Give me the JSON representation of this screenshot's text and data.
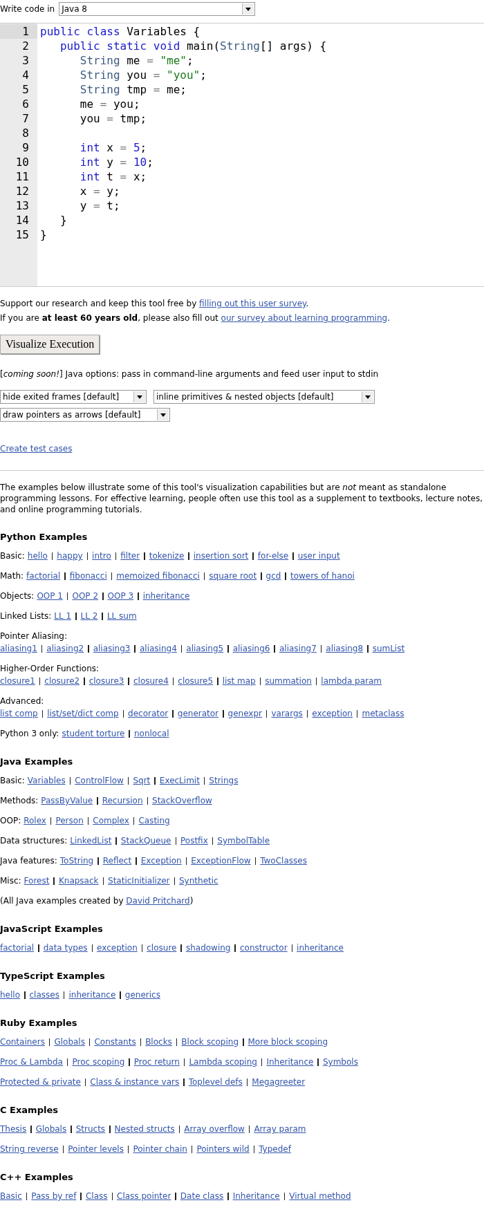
{
  "language_picker": {
    "label": "Write code in",
    "value": "Java 8"
  },
  "editor": {
    "lines": [
      {
        "number": "1",
        "active": true,
        "tokens": [
          {
            "kind": "keyword",
            "text": "public class"
          },
          {
            "kind": "plain",
            "text": " Variables {"
          }
        ]
      },
      {
        "number": "2",
        "active": false,
        "tokens": [
          {
            "kind": "keyword",
            "text": "   public static void"
          },
          {
            "kind": "plain",
            "text": " main("
          },
          {
            "kind": "type",
            "text": "String"
          },
          {
            "kind": "plain",
            "text": "[] args) {"
          }
        ]
      },
      {
        "number": "3",
        "active": false,
        "tokens": [
          {
            "kind": "type",
            "text": "      String"
          },
          {
            "kind": "plain",
            "text": " me "
          },
          {
            "kind": "operator",
            "text": "="
          },
          {
            "kind": "string",
            "text": " \"me\""
          },
          {
            "kind": "plain",
            "text": ";"
          }
        ]
      },
      {
        "number": "4",
        "active": false,
        "tokens": [
          {
            "kind": "type",
            "text": "      String"
          },
          {
            "kind": "plain",
            "text": " you "
          },
          {
            "kind": "operator",
            "text": "="
          },
          {
            "kind": "string",
            "text": " \"you\""
          },
          {
            "kind": "plain",
            "text": ";"
          }
        ]
      },
      {
        "number": "5",
        "active": false,
        "tokens": [
          {
            "kind": "type",
            "text": "      String"
          },
          {
            "kind": "plain",
            "text": " tmp "
          },
          {
            "kind": "operator",
            "text": "="
          },
          {
            "kind": "plain",
            "text": " me;"
          }
        ]
      },
      {
        "number": "6",
        "active": false,
        "tokens": [
          {
            "kind": "plain",
            "text": "      me "
          },
          {
            "kind": "operator",
            "text": "="
          },
          {
            "kind": "plain",
            "text": " you;"
          }
        ]
      },
      {
        "number": "7",
        "active": false,
        "tokens": [
          {
            "kind": "plain",
            "text": "      you "
          },
          {
            "kind": "operator",
            "text": "="
          },
          {
            "kind": "plain",
            "text": " tmp;"
          }
        ]
      },
      {
        "number": "8",
        "active": false
      },
      {
        "number": "9",
        "active": false,
        "tokens": [
          {
            "kind": "keyword",
            "text": "      int"
          },
          {
            "kind": "plain",
            "text": " x "
          },
          {
            "kind": "operator",
            "text": "="
          },
          {
            "kind": "number",
            "text": " 5"
          },
          {
            "kind": "plain",
            "text": ";"
          }
        ]
      },
      {
        "number": "10",
        "active": false,
        "tokens": [
          {
            "kind": "keyword",
            "text": "      int"
          },
          {
            "kind": "plain",
            "text": " y "
          },
          {
            "kind": "operator",
            "text": "="
          },
          {
            "kind": "number",
            "text": " 10"
          },
          {
            "kind": "plain",
            "text": ";"
          }
        ]
      },
      {
        "number": "11",
        "active": false,
        "tokens": [
          {
            "kind": "keyword",
            "text": "      int"
          },
          {
            "kind": "plain",
            "text": " t "
          },
          {
            "kind": "operator",
            "text": "="
          },
          {
            "kind": "plain",
            "text": " x;"
          }
        ]
      },
      {
        "number": "12",
        "active": false,
        "tokens": [
          {
            "kind": "plain",
            "text": "      x "
          },
          {
            "kind": "operator",
            "text": "="
          },
          {
            "kind": "plain",
            "text": " y;"
          }
        ]
      },
      {
        "number": "13",
        "active": false,
        "tokens": [
          {
            "kind": "plain",
            "text": "      y "
          },
          {
            "kind": "operator",
            "text": "="
          },
          {
            "kind": "plain",
            "text": " t;"
          }
        ]
      },
      {
        "number": "14",
        "active": false,
        "tokens": [
          {
            "kind": "plain",
            "text": "   }"
          }
        ]
      },
      {
        "number": "15",
        "active": false,
        "tokens": [
          {
            "kind": "plain",
            "text": "}"
          }
        ]
      }
    ]
  },
  "notices": [
    {
      "before": "Support our research and keep this tool free by ",
      "link": "filling out this user survey",
      "after": "."
    },
    {
      "before": "If you are **at least 60 years old**, please also fill out ",
      "link": "our survey about learning programming",
      "after": "."
    }
  ],
  "visualize_button": "Visualize Execution",
  "options_note": "[*coming soon!*] Java options: pass in command-line arguments and feed user input to stdin",
  "option_selects": [
    {
      "value": "hide exited frames [default]"
    },
    {
      "value": "inline primitives & nested objects [default]"
    },
    {
      "value": "draw pointers as arrows [default]"
    }
  ],
  "create_test_cases": "Create test cases",
  "intro": "The examples below illustrate some of this tool's visualization capabilities but are *not* meant as standalone programming lessons. For effective learning, people often use this tool as a supplement to textbooks, lecture notes, and online programming tutorials.",
  "sections": [
    {
      "heading": "Python Examples",
      "rows": [
        {
          "kind": "inline",
          "label": "Basic:",
          "links": [
            "hello",
            "happy",
            "intro",
            "filter",
            "tokenize",
            "insertion sort",
            "for-else",
            "user input"
          ]
        },
        {
          "kind": "inline",
          "label": "Math:",
          "links": [
            "factorial",
            "fibonacci",
            "memoized fibonacci",
            "square root",
            "gcd",
            "towers of hanoi"
          ]
        },
        {
          "kind": "inline",
          "label": "Objects:",
          "links": [
            "OOP 1",
            "OOP 2",
            "OOP 3",
            "inheritance"
          ]
        },
        {
          "kind": "inline",
          "label": "Linked Lists:",
          "links": [
            "LL 1",
            "LL 2",
            "LL sum"
          ]
        },
        {
          "kind": "stacked",
          "label": "Pointer Aliasing:",
          "links": [
            "aliasing1",
            "aliasing2",
            "aliasing3",
            "aliasing4",
            "aliasing5",
            "aliasing6",
            "aliasing7",
            "aliasing8",
            "sumList"
          ]
        },
        {
          "kind": "stacked",
          "label": "Higher-Order Functions:",
          "links": [
            "closure1",
            "closure2",
            "closure3",
            "closure4",
            "closure5",
            "list map",
            "summation",
            "lambda param"
          ]
        },
        {
          "kind": "stacked",
          "label": "Advanced:",
          "links": [
            "list comp",
            "list/set/dict comp",
            "decorator",
            "generator",
            "genexpr",
            "varargs",
            "exception",
            "metaclass"
          ]
        },
        {
          "kind": "inline",
          "label": "Python 3 only:",
          "links": [
            "student torture",
            "nonlocal"
          ]
        }
      ]
    },
    {
      "heading": "Java Examples",
      "rows": [
        {
          "kind": "inline",
          "label": "Basic:",
          "links": [
            "Variables",
            "ControlFlow",
            "Sqrt",
            "ExecLimit",
            "Strings"
          ]
        },
        {
          "kind": "inline",
          "label": "Methods:",
          "links": [
            "PassByValue",
            "Recursion",
            "StackOverflow"
          ]
        },
        {
          "kind": "inline",
          "label": "OOP:",
          "links": [
            "Rolex",
            "Person",
            "Complex",
            "Casting"
          ]
        },
        {
          "kind": "inline",
          "label": "Data structures:",
          "links": [
            "LinkedList",
            "StackQueue",
            "Postfix",
            "SymbolTable"
          ]
        },
        {
          "kind": "inline",
          "label": "Java features:",
          "links": [
            "ToString",
            "Reflect",
            "Exception",
            "ExceptionFlow",
            "TwoClasses"
          ]
        },
        {
          "kind": "inline",
          "label": "Misc:",
          "links": [
            "Forest",
            "Knapsack",
            "StaticInitializer",
            "Synthetic"
          ]
        },
        {
          "kind": "note",
          "before": "(All Java examples created by ",
          "link": "David Pritchard",
          "after": ")"
        }
      ]
    },
    {
      "heading": "JavaScript Examples",
      "rows": [
        {
          "kind": "inline",
          "links": [
            "factorial",
            "data types",
            "exception",
            "closure",
            "shadowing",
            "constructor",
            "inheritance"
          ]
        }
      ]
    },
    {
      "heading": "TypeScript Examples",
      "rows": [
        {
          "kind": "inline",
          "links": [
            "hello",
            "classes",
            "inheritance",
            "generics"
          ]
        }
      ]
    },
    {
      "heading": "Ruby Examples",
      "rows": [
        {
          "kind": "inline",
          "links": [
            "Containers",
            "Globals",
            "Constants",
            "Blocks",
            "Block scoping",
            "More block scoping"
          ]
        },
        {
          "kind": "inline",
          "links": [
            "Proc & Lambda",
            "Proc scoping",
            "Proc return",
            "Lambda scoping",
            "Inheritance",
            "Symbols"
          ]
        },
        {
          "kind": "inline",
          "links": [
            "Protected & private",
            "Class & instance vars",
            "Toplevel defs",
            "Megagreeter"
          ]
        }
      ]
    },
    {
      "heading": "C Examples",
      "rows": [
        {
          "kind": "inline",
          "links": [
            "Thesis",
            "Globals",
            "Structs",
            "Nested structs",
            "Array overflow",
            "Array param"
          ]
        },
        {
          "kind": "inline",
          "links": [
            "String reverse",
            "Pointer levels",
            "Pointer chain",
            "Pointers wild",
            "Typedef"
          ]
        }
      ]
    },
    {
      "heading": "C++ Examples",
      "rows": [
        {
          "kind": "inline",
          "links": [
            "Basic",
            "Pass by ref",
            "Class",
            "Class pointer",
            "Date class",
            "Inheritance",
            "Virtual method"
          ]
        }
      ]
    }
  ]
}
